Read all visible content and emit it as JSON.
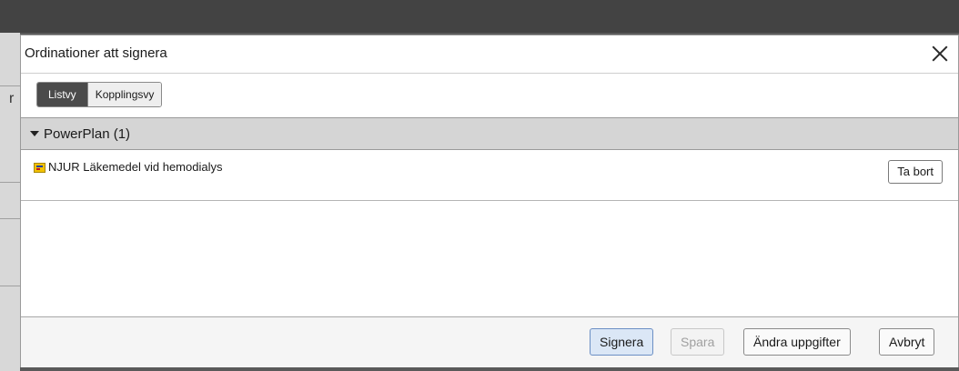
{
  "dialog": {
    "title": "Ordinationer att signera",
    "close_icon": "close-icon"
  },
  "view_toggle": {
    "options": [
      "Listvy",
      "Kopplingsvy"
    ],
    "selected": "Listvy"
  },
  "background": {
    "partial_text": "r"
  },
  "groups": [
    {
      "label": "PowerPlan (1)",
      "expanded": true,
      "items": [
        {
          "icon": "powerplan-icon",
          "label": "NJUR Läkemedel vid hemodialys",
          "action_label": "Ta bort"
        }
      ]
    }
  ],
  "footer": {
    "sign_label": "Signera",
    "save_label": "Spara",
    "edit_label": "Ändra uppgifter",
    "cancel_label": "Avbryt",
    "save_disabled": true
  },
  "colors": {
    "primary_button_bg": "#dbe7f6",
    "primary_button_border": "#6b8fc4",
    "group_header_bg": "#d5d5d5",
    "segment_active_bg": "#4b4b4b"
  }
}
